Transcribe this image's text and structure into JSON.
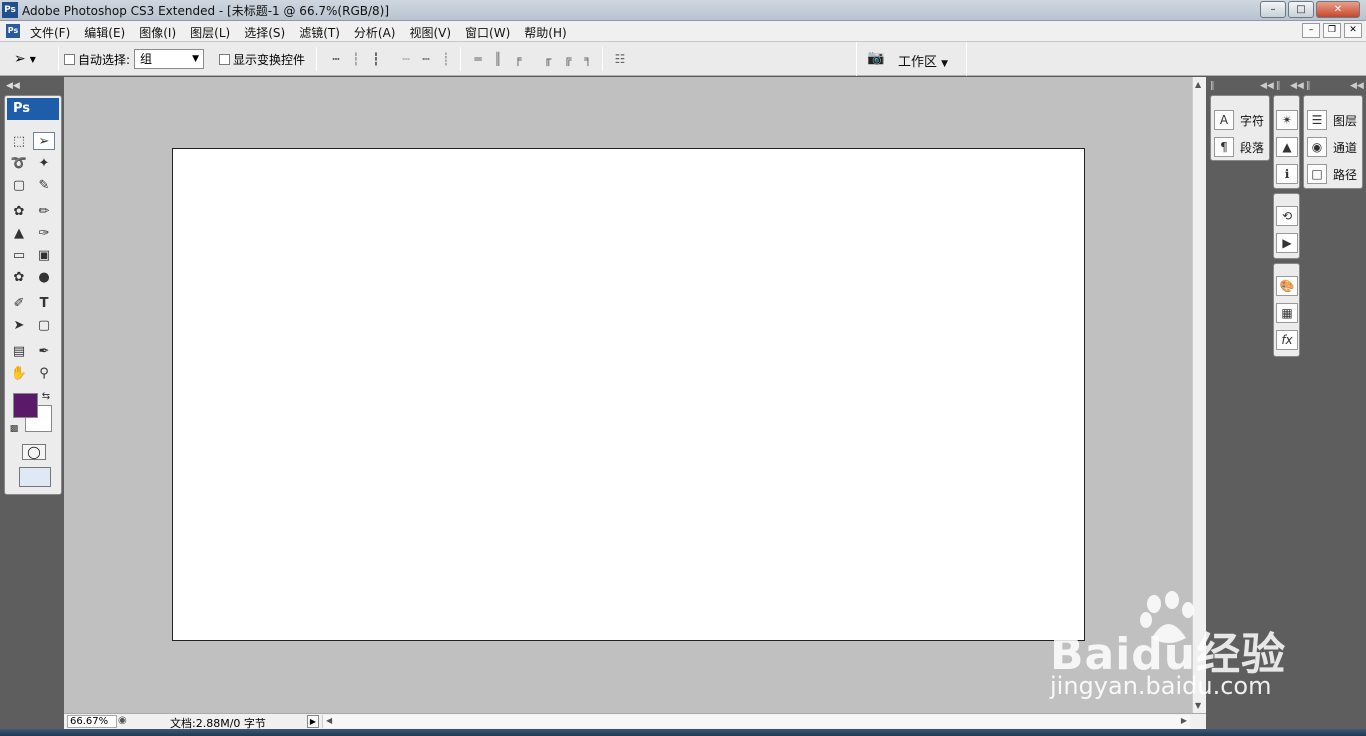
{
  "window": {
    "title": "Adobe Photoshop CS3 Extended - [未标题-1 @ 66.7%(RGB/8)]",
    "app_icon": "Ps",
    "buttons": [
      "minimize-icon",
      "maximize-icon",
      "close-icon"
    ]
  },
  "menu": {
    "doc_icon": "Ps",
    "items": [
      "文件(F)",
      "编辑(E)",
      "图像(I)",
      "图层(L)",
      "选择(S)",
      "滤镜(T)",
      "分析(A)",
      "视图(V)",
      "窗口(W)",
      "帮助(H)"
    ]
  },
  "options": {
    "auto_select_label": "自动选择:",
    "auto_select_value": "组",
    "show_transform_label": "显示变换控件",
    "workspace_label": "工作区",
    "auto_select_checked": false,
    "show_transform_checked": false
  },
  "toolbox": {
    "logo": "Ps",
    "foreground_color": "#5a1a6a",
    "background_color": "#ffffff"
  },
  "document": {
    "zoom": "66.67%",
    "info": "文档:2.88M/0 字节",
    "canvas_color": "#ffffff"
  },
  "panels": {
    "character": "字符",
    "paragraph": "段落",
    "layers": "图层",
    "channels": "通道",
    "paths": "路径"
  },
  "watermark": {
    "brand": "Baidu经验",
    "url": "jingyan.baidu.com"
  }
}
